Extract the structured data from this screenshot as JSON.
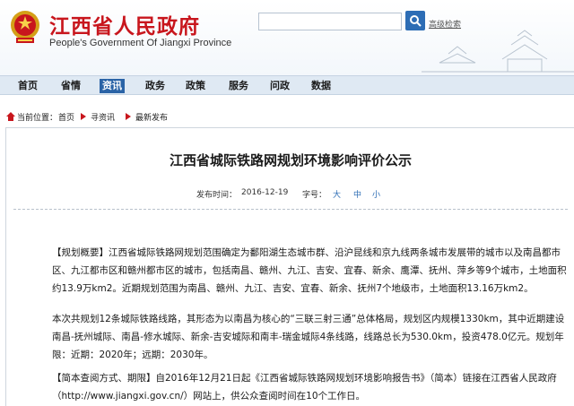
{
  "header": {
    "title": "江西省人民政府",
    "title_en": "People's Government Of Jiangxi Province",
    "search_placeholder": "",
    "advanced_search": "高级检索"
  },
  "nav": {
    "items": [
      "首页",
      "省情",
      "资讯",
      "政务",
      "政策",
      "服务",
      "问政",
      "数据"
    ],
    "active_index": 2
  },
  "breadcrumb": {
    "prefix": "当前位置：",
    "items": [
      "首页",
      "寻资讯",
      "最新发布"
    ]
  },
  "article": {
    "title": "江西省城际铁路网规划环境影响评价公示",
    "date_label": "发布时间：",
    "date": "2016-12-19",
    "font_label": "字号：",
    "font_sizes": [
      "大",
      "中",
      "小"
    ],
    "paragraphs": [
      "【规划概要】江西省城际铁路网规划范围确定为鄱阳湖生态城市群、沿沪昆线和京九线两条城市发展带的城市以及南昌都市区、九江都市区和赣州都市区的城市，包括南昌、赣州、九江、吉安、宜春、新余、鹰潭、抚州、萍乡等9个城市，土地面积约13.9万km2。近期规划范围为南昌、赣州、九江、吉安、宜春、新余、抚州7个地级市，土地面积13.16万km2。",
      "本次共规划12条城际铁路线路，其形态为以南昌为核心的“三联三射三通”总体格局，规划区内规模1330km，其中近期建设南昌-抚州城际、南昌-修水城际、新余-吉安城际和南丰-瑞金城际4条线路，线路总长为530.0km，投资478.0亿元。规划年限：近期：2020年；远期：2030年。",
      "【简本查阅方式、期限】自2016年12月21日起《江西省城际铁路网规划环境影响报告书》（简本）链接在江西省人民政府（http://www.jiangxi.gov.cn/）网站上，供公众查阅时间在10个工作日。"
    ]
  },
  "colors": {
    "brand_red": "#c8161d",
    "nav_active": "#2a63a6",
    "link_blue": "#2d6db5"
  }
}
